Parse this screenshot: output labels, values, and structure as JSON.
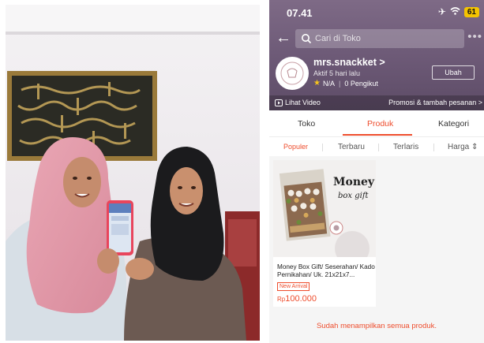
{
  "photo": {
    "description_icon": "two-women-showing-phone-photo"
  },
  "status_bar": {
    "time": "07.41",
    "battery": "61",
    "airplane_icon": "airplane-icon",
    "wifi_icon": "wifi-icon"
  },
  "search": {
    "placeholder": "Cari di Toko"
  },
  "shop": {
    "name": "mrs.snackket",
    "name_chevron": ">",
    "active": "Aktif 5 hari lalu",
    "rating": "N/A",
    "followers": "0 Pengikut",
    "edit_label": "Ubah"
  },
  "video_bar": {
    "video_label": "Lihat Video",
    "promo_label": "Promosi & tambah pesanan"
  },
  "tabs": [
    {
      "label": "Toko"
    },
    {
      "label": "Produk"
    },
    {
      "label": "Kategori"
    }
  ],
  "active_tab": "Produk",
  "sorts": [
    {
      "label": "Populer"
    },
    {
      "label": "Terbaru"
    },
    {
      "label": "Terlaris"
    },
    {
      "label": "Harga"
    }
  ],
  "product": {
    "image_text_1": "Money",
    "image_text_2": "box gift",
    "title": "Money Box Gift/ Seserahan/ Kado Pernikahan/ Uk. 21x21x7...",
    "badge": "New Arrival",
    "currency": "Rp",
    "price": "100.000"
  },
  "footer_note": "Sudah menampilkan semua produk.",
  "colors": {
    "accent": "#ee4d2d",
    "header": "#6a5774",
    "star": "#f7c51c"
  }
}
